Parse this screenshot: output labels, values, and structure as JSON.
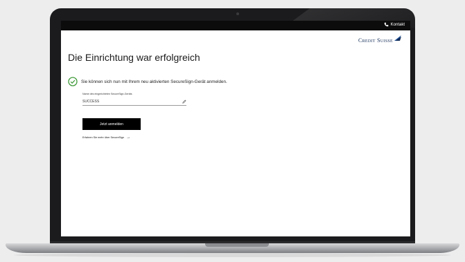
{
  "header": {
    "contact_label": "Kontakt",
    "logo_text": "Credit Suisse"
  },
  "main": {
    "title": "Die Einrichtung war erfolgreich",
    "success_message": "Sie können sich nun mit Ihrem neu aktivierten SecureSign-Gerät anmelden.",
    "device_field": {
      "label": "Name des eingerichteten SecureSign-Geräts",
      "value": "SUCCESS"
    },
    "login_button": "Jetzt anmelden",
    "learn_more_link": "Erfahren Sie mehr über SecureSign"
  },
  "colors": {
    "success_green": "#3f9a3a",
    "brand_navy": "#102a56",
    "topbar": "#0c0c0c",
    "button": "#000000"
  },
  "icons": [
    "phone-icon",
    "credit-suisse-sails-icon",
    "checkmark-circle-icon",
    "edit-pencil-icon",
    "arrow-right-icon"
  ]
}
